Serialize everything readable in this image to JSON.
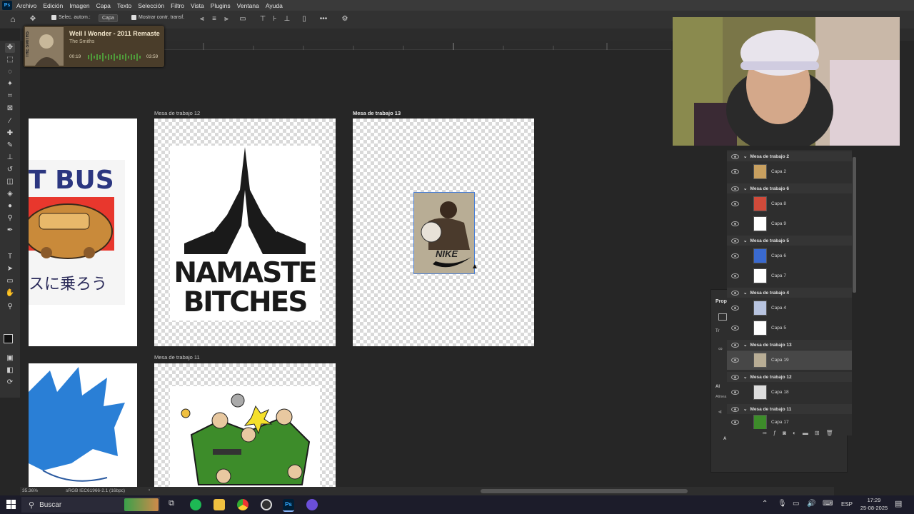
{
  "menu": {
    "app_icon": "Ps",
    "items": [
      "Archivo",
      "Edición",
      "Imagen",
      "Capa",
      "Texto",
      "Selección",
      "Filtro",
      "Vista",
      "Plugins",
      "Ventana",
      "Ayuda"
    ]
  },
  "options": {
    "auto_select_label": "Selec. autom.:",
    "auto_select_value": "Capa",
    "show_transform_label": "Mostrar contr. transf.",
    "more_icon": "•••"
  },
  "music": {
    "title": "Well I Wonder - 2011 Remaste",
    "artist": "The Smiths",
    "album_text": "THE SMITHS",
    "elapsed": "00:19",
    "duration": "03:59"
  },
  "artboards": {
    "ab12_label": "Mesa de trabajo 12",
    "ab13_label": "Mesa de trabajo 13",
    "ab11_label": "Mesa de trabajo 11",
    "bus_text": "T BUS",
    "jp_text": "スに乗ろう",
    "namaste_line1": "NAMASTE",
    "namaste_line2": "BITCHES",
    "nike_text": "NIKE"
  },
  "layers": [
    {
      "type": "group",
      "name": "Mesa de trabajo 2"
    },
    {
      "type": "layer",
      "name": "Capa 2"
    },
    {
      "type": "group",
      "name": "Mesa de trabajo 6"
    },
    {
      "type": "layer",
      "name": "Capa 8"
    },
    {
      "type": "layer",
      "name": "Capa 9"
    },
    {
      "type": "group",
      "name": "Mesa de trabajo 5"
    },
    {
      "type": "layer",
      "name": "Capa 6"
    },
    {
      "type": "layer",
      "name": "Capa 7"
    },
    {
      "type": "group",
      "name": "Mesa de trabajo 4"
    },
    {
      "type": "layer",
      "name": "Capa 4"
    },
    {
      "type": "layer",
      "name": "Capa 5"
    },
    {
      "type": "group",
      "name": "Mesa de trabajo 13"
    },
    {
      "type": "layer",
      "name": "Capa 19",
      "selected": true
    },
    {
      "type": "group",
      "name": "Mesa de trabajo 12"
    },
    {
      "type": "layer",
      "name": "Capa 18"
    },
    {
      "type": "group",
      "name": "Mesa de trabajo 11"
    },
    {
      "type": "layer",
      "name": "Capa 17"
    }
  ],
  "props": {
    "title": "Prop",
    "tr": "Tr",
    "al": "Al",
    "alinea": "Alinea",
    "a": "A"
  },
  "status": {
    "zoom": "35.36%",
    "profile": "sRGB IEC61966-2.1 (16bpc)"
  },
  "taskbar": {
    "search_placeholder": "Buscar",
    "lang": "ESP",
    "time": "17:29",
    "date": "25-08-2025"
  },
  "colors": {
    "accent": "#31a8ff",
    "taskbar": "#1c1c2a"
  }
}
